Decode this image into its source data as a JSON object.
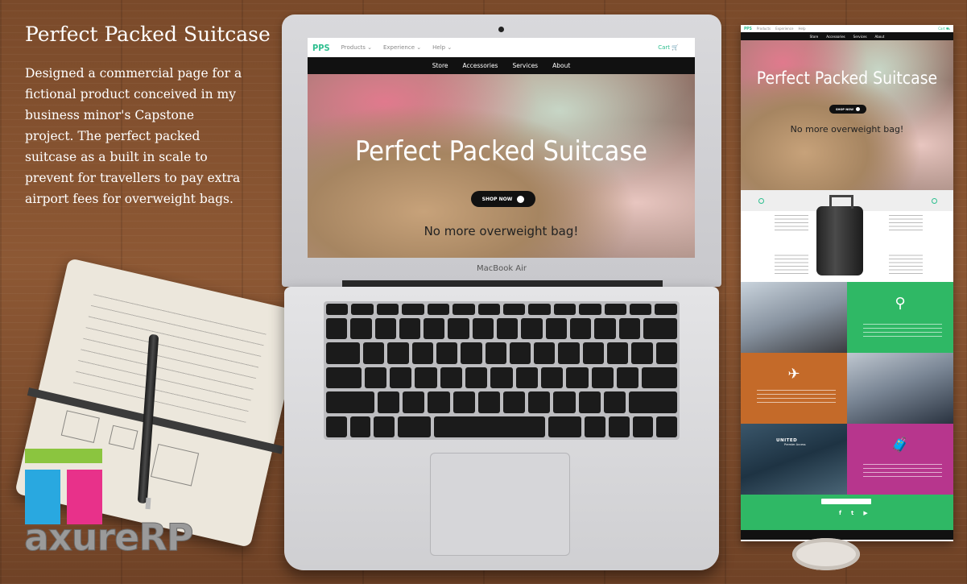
{
  "intro": {
    "title": "Perfect Packed Suitcase",
    "description": "Designed a commercial page for a fictional product conceived in my business minor's Capstone project. The perfect packed suitcase as a built in scale to prevent for travellers to pay extra airport fees for overweight bags."
  },
  "laptop": {
    "brand": "MacBook Air"
  },
  "site": {
    "logo": "PPS",
    "menu": [
      "Products",
      "Experience",
      "Help"
    ],
    "cart": "Cart",
    "subnav": [
      "Store",
      "Accessories",
      "Services",
      "About"
    ],
    "hero_title": "Perfect Packed Suitcase",
    "shop_button": "SHOP NOW",
    "tagline": "No more overweight bag!"
  },
  "logo": {
    "wordmark": "axureRP",
    "colors": {
      "green": "#8bc53f",
      "blue": "#29a8e0",
      "pink": "#e8318a"
    }
  },
  "colors": {
    "accent": "#2ebf8f",
    "green_panel": "#2fb865",
    "orange_panel": "#c46a29",
    "magenta_panel": "#b7368d"
  },
  "icons": [
    "chevron-down-icon",
    "cart-icon",
    "arrow-right-icon",
    "map-pin-icon",
    "ticket-icon",
    "luggage-cart-icon",
    "facebook-icon",
    "twitter-icon",
    "youtube-icon"
  ]
}
